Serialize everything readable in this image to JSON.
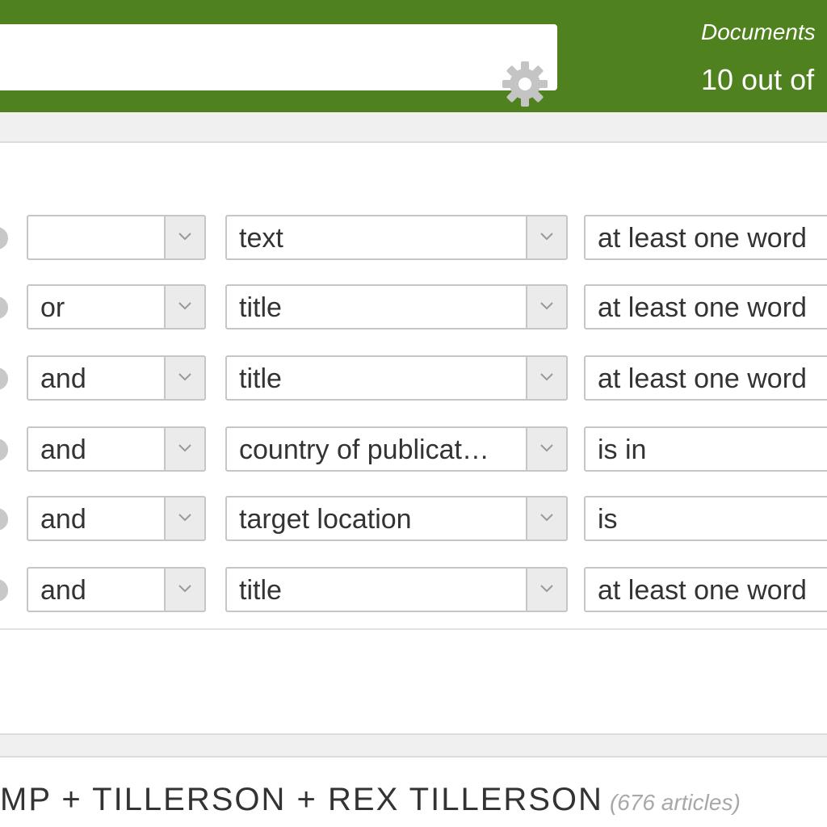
{
  "header": {
    "search_value": "",
    "documents_label": "Documents",
    "documents_count": "10 out of",
    "accent_color": "#4f821f",
    "settings_icon": "gear-icon"
  },
  "filters": [
    {
      "operator": "",
      "field": "text",
      "condition": "at least one word"
    },
    {
      "operator": "or",
      "field": "title",
      "condition": "at least one word"
    },
    {
      "operator": "and",
      "field": "title",
      "condition": "at least one word"
    },
    {
      "operator": "and",
      "field": "country of publicat…",
      "condition": "is in"
    },
    {
      "operator": "and",
      "field": "target location",
      "condition": "is"
    },
    {
      "operator": "and",
      "field": "title",
      "condition": "at least one word"
    }
  ],
  "query": {
    "title": "MP + TILLERSON + REX TILLERSON",
    "count": "(676 articles)"
  }
}
